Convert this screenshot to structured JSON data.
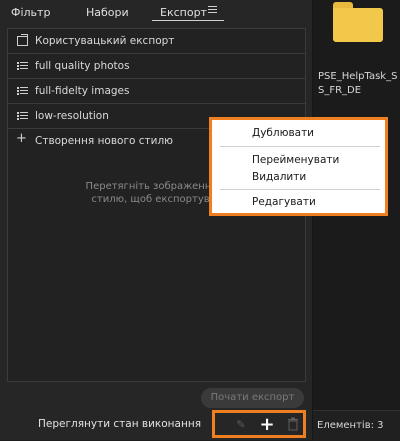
{
  "tabs": [
    "Фільтр",
    "Набори",
    "Експорт"
  ],
  "export_presets": [
    {
      "label": "Користувацький експорт",
      "icon": "export-icon"
    },
    {
      "label": "full quality photos",
      "icon": "list-icon"
    },
    {
      "label": "full-fidelty images",
      "icon": "list-icon"
    },
    {
      "label": "low-resolution",
      "icon": "list-icon"
    }
  ],
  "new_style_label": "Створення нового стилю",
  "hint_line1": "Перетягніть зображення д",
  "hint_line2": "стилю, щоб експортуват",
  "start_export_label": "Почати експорт",
  "view_status_label": "Переглянути стан виконання",
  "context_menu": {
    "duplicate": "Дублювати",
    "rename": "Перейменувати",
    "delete": "Видалити",
    "edit": "Редагувати"
  },
  "file": {
    "name": "PSE_HelpTask_SS_FR_DE"
  },
  "elements_count_label": "Елементів: 3",
  "colors": {
    "accent": "#f07f22",
    "folder": "#f2c84b"
  }
}
